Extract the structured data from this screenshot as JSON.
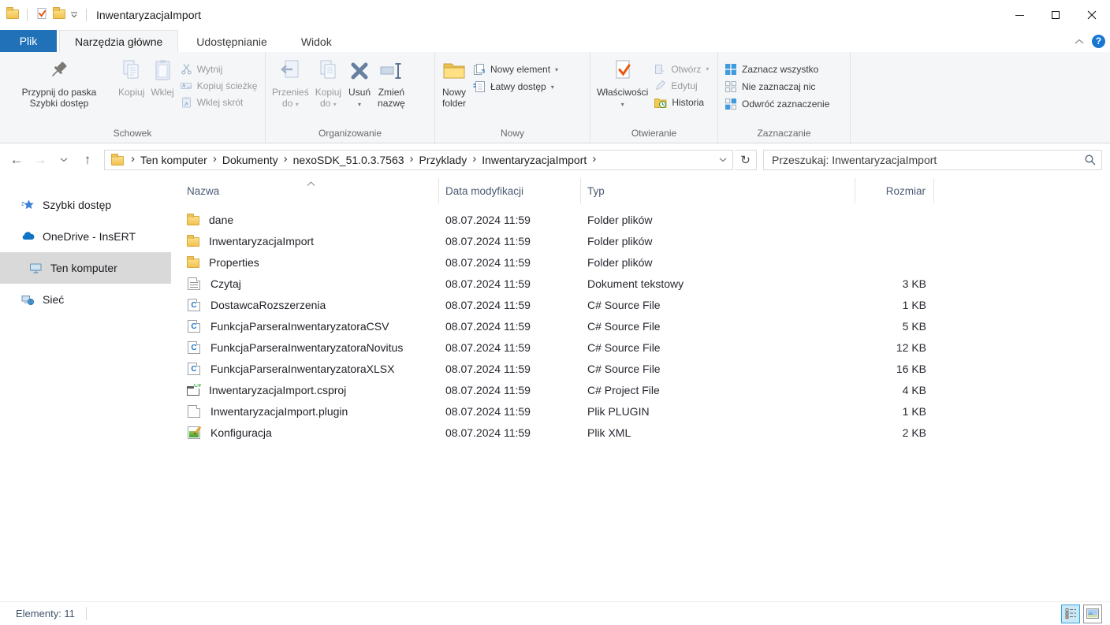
{
  "window": {
    "title": "InwentaryzacjaImport"
  },
  "icons": {
    "back": "←",
    "forward": "→",
    "up": "↑",
    "refresh": "↻",
    "breadcrumb_chevron": "›",
    "dropdown_arrow": "▾",
    "help": "?"
  },
  "tabs": {
    "file_label": "Plik",
    "items": [
      {
        "label": "Narzędzia główne",
        "active": true
      },
      {
        "label": "Udostępnianie",
        "active": false
      },
      {
        "label": "Widok",
        "active": false
      }
    ]
  },
  "ribbon": {
    "schowek": {
      "label": "Schowek",
      "pin_l1": "Przypnij do paska",
      "pin_l2": "Szybki dostęp",
      "kopiuj": "Kopiuj",
      "wklej": "Wklej",
      "wytnij": "Wytnij",
      "kopiuj_sciezke": "Kopiuj ścieżkę",
      "wklej_skrot": "Wklej skrót"
    },
    "organizowanie": {
      "label": "Organizowanie",
      "przenies_l1": "Przenieś",
      "przenies_l2": "do",
      "kopiuj_do_l1": "Kopiuj",
      "kopiuj_do_l2": "do",
      "usun": "Usuń",
      "zmien_l1": "Zmień",
      "zmien_l2": "nazwę"
    },
    "nowy": {
      "label": "Nowy",
      "nowy_folder_l1": "Nowy",
      "nowy_folder_l2": "folder",
      "nowy_element": "Nowy element",
      "latwy_dostep": "Łatwy dostęp"
    },
    "otwieranie": {
      "label": "Otwieranie",
      "wlasciwosci": "Właściwości",
      "otworz": "Otwórz",
      "edytuj": "Edytuj",
      "historia": "Historia"
    },
    "zaznaczanie": {
      "label": "Zaznaczanie",
      "zaznacz": "Zaznacz wszystko",
      "nie_zaznaczaj": "Nie zaznaczaj nic",
      "odwroc": "Odwróć zaznaczenie"
    }
  },
  "addressbar": {
    "crumbs": [
      "Ten komputer",
      "Dokumenty",
      "nexoSDK_51.0.3.7563",
      "Przyklady",
      "InwentaryzacjaImport"
    ],
    "search_placeholder": "Przeszukaj: InwentaryzacjaImport"
  },
  "sidebar": {
    "items": [
      {
        "label": "Szybki dostęp",
        "icon": "quick-access-star",
        "selected": false
      },
      {
        "label": "OneDrive - InsERT",
        "icon": "onedrive-cloud",
        "selected": false
      },
      {
        "label": "Ten komputer",
        "icon": "this-pc-monitor",
        "selected": true
      },
      {
        "label": "Sieć",
        "icon": "network",
        "selected": false
      }
    ]
  },
  "filelist": {
    "columns": {
      "name": "Nazwa",
      "date": "Data modyfikacji",
      "type": "Typ",
      "size": "Rozmiar"
    },
    "rows": [
      {
        "name": "dane",
        "icon": "folder",
        "date": "08.07.2024 11:59",
        "type": "Folder plików",
        "size": ""
      },
      {
        "name": "InwentaryzacjaImport",
        "icon": "folder",
        "date": "08.07.2024 11:59",
        "type": "Folder plików",
        "size": ""
      },
      {
        "name": "Properties",
        "icon": "folder",
        "date": "08.07.2024 11:59",
        "type": "Folder plików",
        "size": ""
      },
      {
        "name": "Czytaj",
        "icon": "textdoc",
        "date": "08.07.2024 11:59",
        "type": "Dokument tekstowy",
        "size": "3 KB"
      },
      {
        "name": "DostawcaRozszerzenia",
        "icon": "csharp",
        "date": "08.07.2024 11:59",
        "type": "C# Source File",
        "size": "1 KB"
      },
      {
        "name": "FunkcjaParseraInwentaryzatoraCSV",
        "icon": "csharp",
        "date": "08.07.2024 11:59",
        "type": "C# Source File",
        "size": "5 KB"
      },
      {
        "name": "FunkcjaParseraInwentaryzatoraNovitus",
        "icon": "csharp",
        "date": "08.07.2024 11:59",
        "type": "C# Source File",
        "size": "12 KB"
      },
      {
        "name": "FunkcjaParseraInwentaryzatoraXLSX",
        "icon": "csharp",
        "date": "08.07.2024 11:59",
        "type": "C# Source File",
        "size": "16 KB"
      },
      {
        "name": "InwentaryzacjaImport.csproj",
        "icon": "csproj",
        "date": "08.07.2024 11:59",
        "type": "C# Project File",
        "size": "4 KB"
      },
      {
        "name": "InwentaryzacjaImport.plugin",
        "icon": "plugin",
        "date": "08.07.2024 11:59",
        "type": "Plik PLUGIN",
        "size": "1 KB"
      },
      {
        "name": "Konfiguracja",
        "icon": "xml",
        "date": "08.07.2024 11:59",
        "type": "Plik XML",
        "size": "2 KB"
      }
    ]
  },
  "statusbar": {
    "count": "Elementy: 11"
  },
  "colors": {
    "accent_blue": "#2071b8",
    "selection_blue": "#3f9bdc",
    "folder_yellow": "#f2c14e",
    "view_active_bg": "#cbe8f6",
    "view_active_border": "#39a3dc",
    "header_text": "#4a5b73"
  }
}
